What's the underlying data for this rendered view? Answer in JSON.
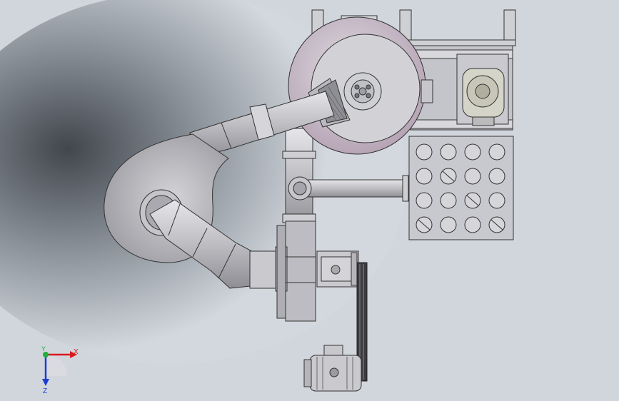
{
  "viewport": {
    "background_light": "#d3d8de",
    "background_dark": "#2b2f35",
    "metal_color": "#c8c8cc",
    "cyclone_tint": "#cdbbc9"
  },
  "triad": {
    "x_label": "X",
    "y_label": "Y",
    "z_label": "Z",
    "x_color": "#d9191f",
    "y_color": "#1fb13c",
    "z_color": "#1e3dd0"
  }
}
